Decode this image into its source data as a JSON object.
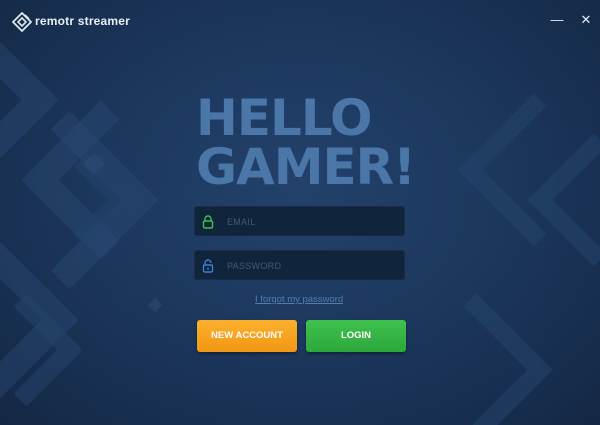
{
  "app": {
    "name": "remotr streamer",
    "logo_icon": "remotr-logo-icon"
  },
  "window_controls": {
    "minimize_label": "—",
    "close_label": "✕"
  },
  "headline": {
    "line1": "HELLO",
    "line2": "GAMER!"
  },
  "form": {
    "email": {
      "placeholder": "EMAIL",
      "value": "",
      "icon": "lock-icon"
    },
    "password": {
      "placeholder": "PASSWORD",
      "value": "",
      "icon": "unlock-icon"
    },
    "forgot_password_label": "I forgot my password",
    "new_account_label": "NEW ACCOUNT",
    "login_label": "LOGIN"
  },
  "colors": {
    "background": "#1d3960",
    "headline": "#4a76a8",
    "accent_orange": "#f7a11f",
    "accent_green": "#35b445",
    "email_icon_green": "#3ec24a",
    "link": "#4f7eb0"
  }
}
